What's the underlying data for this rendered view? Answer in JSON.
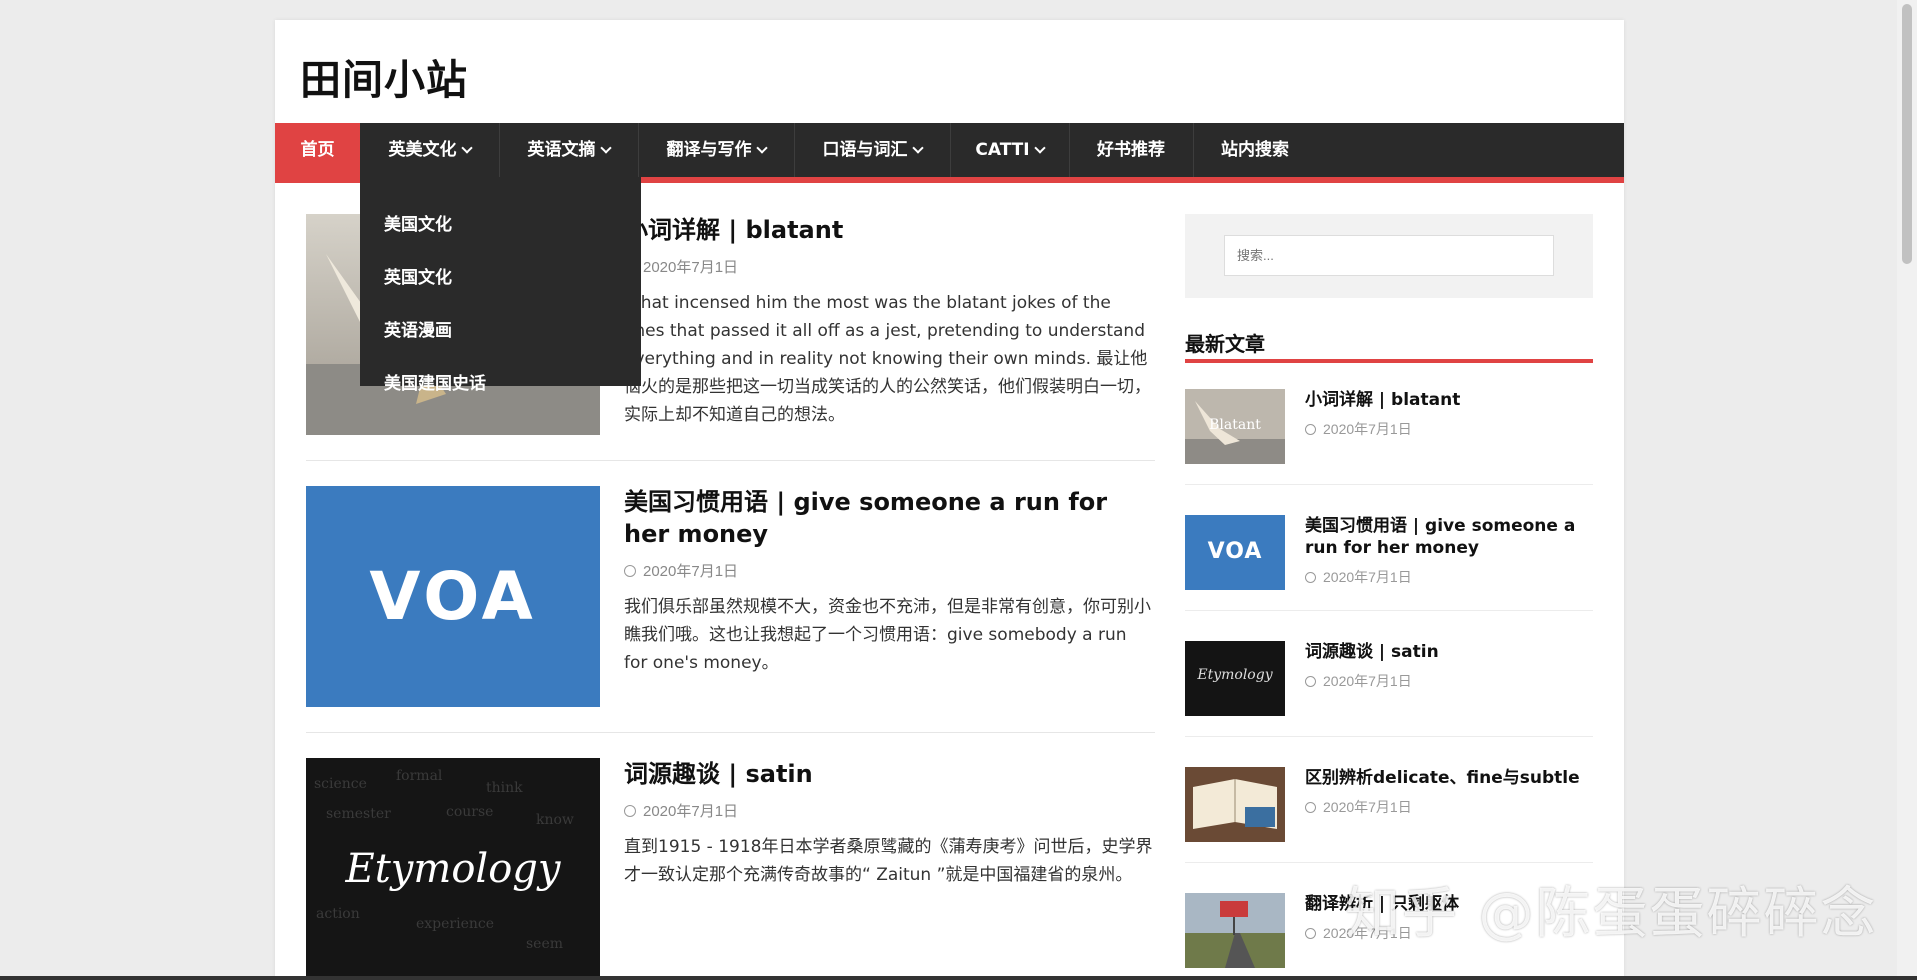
{
  "site": {
    "title": "田间小站"
  },
  "nav": {
    "items": [
      {
        "label": "首页",
        "caret": false,
        "active": true
      },
      {
        "label": "英美文化",
        "caret": true
      },
      {
        "label": "英语文摘",
        "caret": true
      },
      {
        "label": "翻译与写作",
        "caret": true
      },
      {
        "label": "口语与词汇",
        "caret": true
      },
      {
        "label": "CATTI",
        "caret": true
      },
      {
        "label": "好书推荐",
        "caret": false
      },
      {
        "label": "站内搜索",
        "caret": false
      }
    ],
    "dropdown": [
      "美国文化",
      "英国文化",
      "英语漫画",
      "美国建国史话"
    ]
  },
  "posts": [
    {
      "title": "小词详解 | blatant",
      "date": "2020年7月1日",
      "excerpt": "What incensed him the most was the blatant jokes of the ones that passed it all off as a jest, pretending to understand everything and in reality not knowing their own minds. 最让他恼火的是那些把这一切当成笑话的人的公然笑话，他们假装明白一切，实际上却不知道自己的想法。"
    },
    {
      "title": "美国习惯用语 | give someone a run for her money",
      "date": "2020年7月1日",
      "excerpt": "我们俱乐部虽然规模不大，资金也不充沛，但是非常有创意，你可别小瞧我们哦。这也让我想起了一个习惯用语：give somebody a run for one's money。"
    },
    {
      "title": "词源趣谈 | satin",
      "date": "2020年7月1日",
      "excerpt": "直到1915 - 1918年日本学者桑原骘藏的《蒲寿庚考》问世后，史学界才一致认定那个充满传奇故事的“ Zaitun ”就是中国福建省的泉州。"
    }
  ],
  "sidebar": {
    "search_placeholder": "搜索...",
    "recent_title": "最新文章",
    "recent": [
      {
        "title": "小词详解 | blatant",
        "date": "2020年7月1日"
      },
      {
        "title": "美国习惯用语 | give someone a run for her money",
        "date": "2020年7月1日"
      },
      {
        "title": "词源趣谈 | satin",
        "date": "2020年7月1日"
      },
      {
        "title": "区别辨析delicate、fine与subtle",
        "date": "2020年7月1日"
      },
      {
        "title": "翻译辨析 | 只剩躯体",
        "date": "2020年7月1日"
      }
    ]
  },
  "thumbs": {
    "voa": "VOA",
    "etymology": "Etymology",
    "blatant": "Blatant"
  },
  "watermark": "知乎 @陈蛋蛋碎碎念",
  "colors": {
    "accent": "#e04343",
    "nav_bg": "#2a2a2a",
    "voa_blue": "#3b7bbf"
  }
}
